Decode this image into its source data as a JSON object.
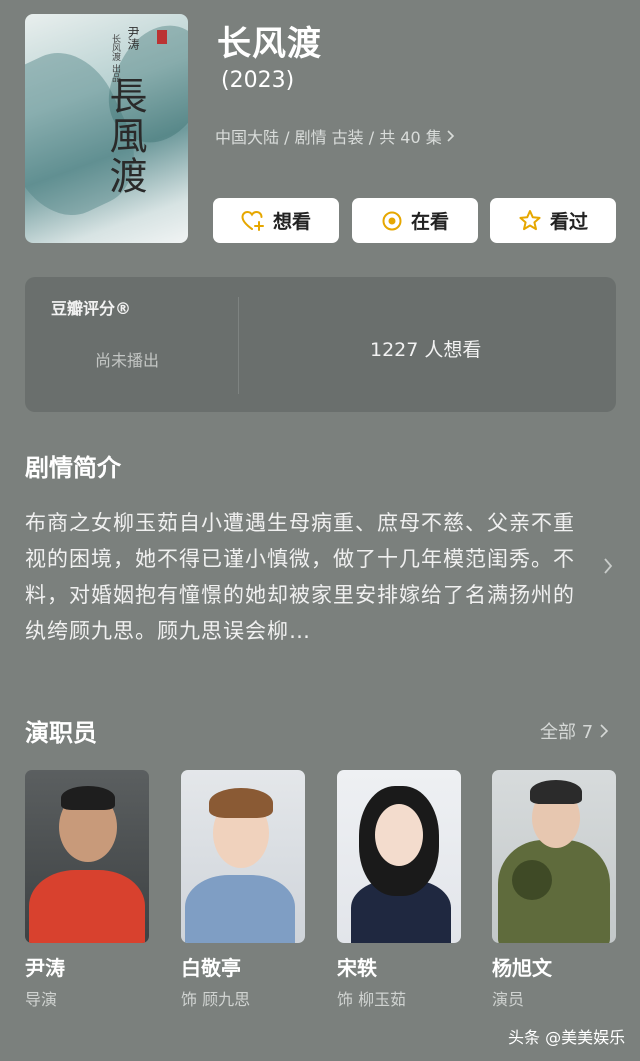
{
  "show": {
    "title": "长风渡",
    "year": "(2023)",
    "meta": "中国大陆 / 剧情 古装 / 共 40 集",
    "poster_title": "長風渡",
    "poster_cast": "尹涛",
    "poster_sub": "长风渡 出品"
  },
  "actions": {
    "want": "想看",
    "watching": "在看",
    "watched": "看过"
  },
  "rating": {
    "label": "豆瓣评分®",
    "status": "尚未播出",
    "want_count": "1227 人想看"
  },
  "synopsis": {
    "title": "剧情简介",
    "text": "布商之女柳玉茹自小遭遇生母病重、庶母不慈、父亲不重视的困境，她不得已谨小慎微，做了十几年模范闺秀。不料，对婚姻抱有憧憬的她却被家里安排嫁给了名满扬州的纨绔顾九思。顾九思误会柳…"
  },
  "cast": {
    "title": "演职员",
    "all_label": "全部 7",
    "members": [
      {
        "name": "尹涛",
        "role": "导演"
      },
      {
        "name": "白敬亭",
        "role": "饰 顾九思"
      },
      {
        "name": "宋轶",
        "role": "饰 柳玉茹"
      },
      {
        "name": "杨旭文",
        "role": "演员"
      }
    ]
  },
  "watermark": "头条 @美美娱乐",
  "colors": {
    "background": "#7b807d",
    "panel": "#6a6f6d",
    "accent_gold": "#e6a700"
  }
}
